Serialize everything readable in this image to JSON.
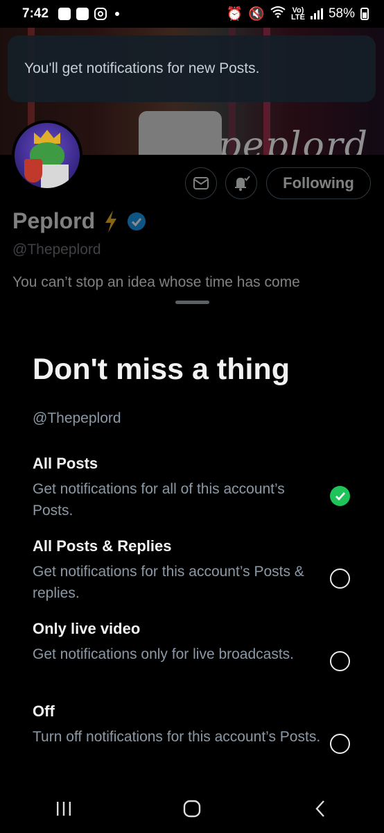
{
  "status_bar": {
    "time": "7:42",
    "battery": "58%",
    "network_top": "Vo)",
    "network_bottom": "LTE"
  },
  "toast": {
    "message": "You'll get notifications for new Posts."
  },
  "banner": {
    "logo_text": "peplord"
  },
  "profile": {
    "name": "Peplord",
    "handle": "@Thepeplord",
    "bio": "You can’t stop an idea whose time has come",
    "following_label": "Following"
  },
  "sheet": {
    "title": "Don't miss a thing",
    "subtitle": "@Thepeplord",
    "options": [
      {
        "title": "All Posts",
        "desc": "Get notifications for all of this account’s Posts.",
        "selected": true
      },
      {
        "title": "All Posts & Replies",
        "desc": "Get notifications for this account’s Posts & replies.",
        "selected": false
      },
      {
        "title": "Only live video",
        "desc": "Get notifications only for live broadcasts.",
        "selected": false
      },
      {
        "title": "Off",
        "desc": "Turn off notifications for this account’s Posts.",
        "selected": false
      }
    ]
  },
  "colors": {
    "accent_check": "#1ec35a",
    "verified": "#1d9bf0",
    "bolt": "#f5b922"
  },
  "icons": [
    "mail-icon",
    "bell-check-icon",
    "verified-badge-icon",
    "lightning-icon",
    "recents-icon",
    "home-icon",
    "back-icon"
  ]
}
